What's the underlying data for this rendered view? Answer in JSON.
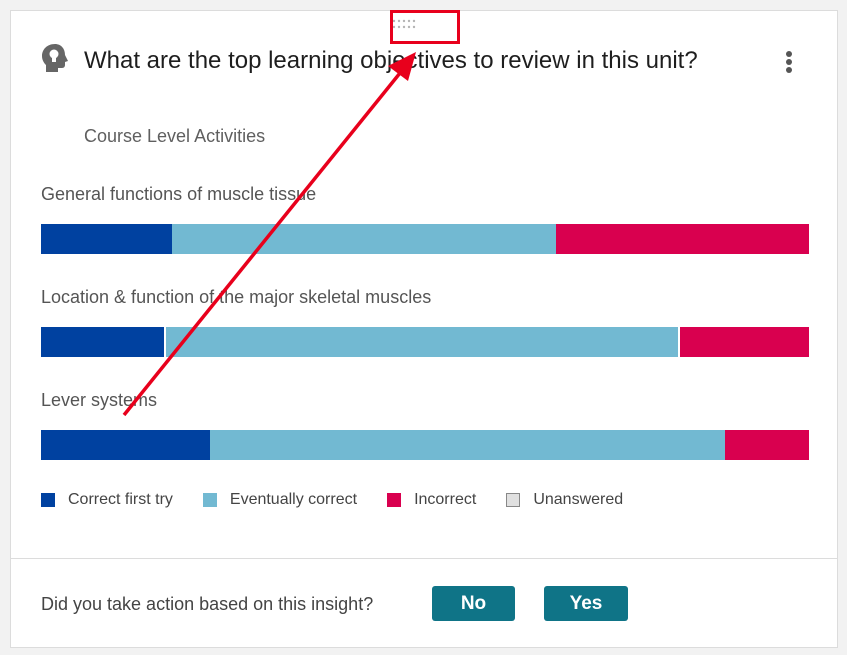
{
  "card": {
    "title": "What are the top learning objectives to review in this unit?",
    "subtitle": "Course Level Activities",
    "icon": "head-lightbulb-icon",
    "menu_icon": "more-vertical-icon"
  },
  "colors": {
    "correct_first_try": "#0041a0",
    "eventually_correct": "#72b9d2",
    "incorrect": "#d9004f",
    "unanswered": "#e0e0e0",
    "action_button": "#0f7487",
    "annotation": "#e8001c"
  },
  "objectives": [
    {
      "label": "General functions of muscle tissue",
      "correct_first_try": 0.17,
      "eventually_correct": 0.5,
      "incorrect": 0.33
    },
    {
      "label": "Location & function of the major skeletal muscles",
      "correct_first_try": 0.16,
      "eventually_correct": 0.67,
      "incorrect": 0.17
    },
    {
      "label": "Lever systems",
      "correct_first_try": 0.22,
      "eventually_correct": 0.67,
      "incorrect": 0.11
    }
  ],
  "legend": [
    {
      "label": "Correct first try"
    },
    {
      "label": "Eventually correct"
    },
    {
      "label": "Incorrect"
    },
    {
      "label": "Unanswered"
    }
  ],
  "footer": {
    "question": "Did you take action based on this insight?",
    "no_label": "No",
    "yes_label": "Yes"
  }
}
